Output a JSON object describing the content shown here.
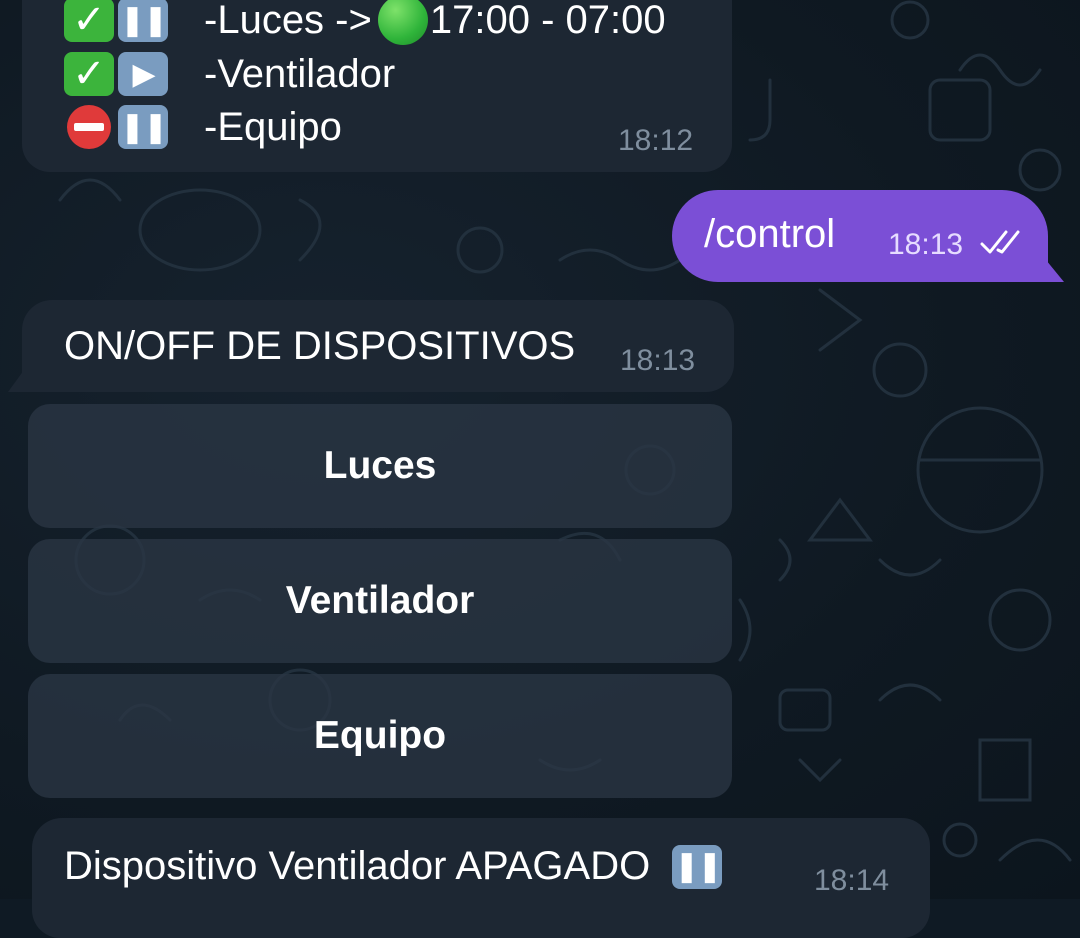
{
  "status_message": {
    "lines": [
      {
        "icons": [
          "check-icon",
          "pause-icon"
        ],
        "label": "-Luces ->",
        "schedule_icon": "green-circle-icon",
        "schedule": "17:00 - 07:00"
      },
      {
        "icons": [
          "check-icon",
          "play-icon"
        ],
        "label": "-Ventilador"
      },
      {
        "icons": [
          "no-entry-icon",
          "pause-icon"
        ],
        "label": "-Equipo"
      }
    ],
    "time": "18:12"
  },
  "command_message": {
    "text": "/control",
    "time": "18:13",
    "status_icon": "double-check-icon"
  },
  "control_message": {
    "text": "ON/OFF DE DISPOSITIVOS",
    "time": "18:13"
  },
  "inline_keyboard": {
    "buttons": [
      "Luces",
      "Ventilador",
      "Equipo"
    ]
  },
  "last_message": {
    "text": "Dispositivo Ventilador APAGADO",
    "icon": "pause-icon",
    "time": "18:14"
  },
  "colors": {
    "background": "#0f1a24",
    "incoming_bubble": "#1d2733",
    "outgoing_bubble": "#7b4fd6",
    "keyboard_button": "#2a3644",
    "timestamp": "#7f8e9e",
    "check": "#3cb43c",
    "pause_play": "#7a9cc0",
    "no_entry": "#e03a3a"
  }
}
